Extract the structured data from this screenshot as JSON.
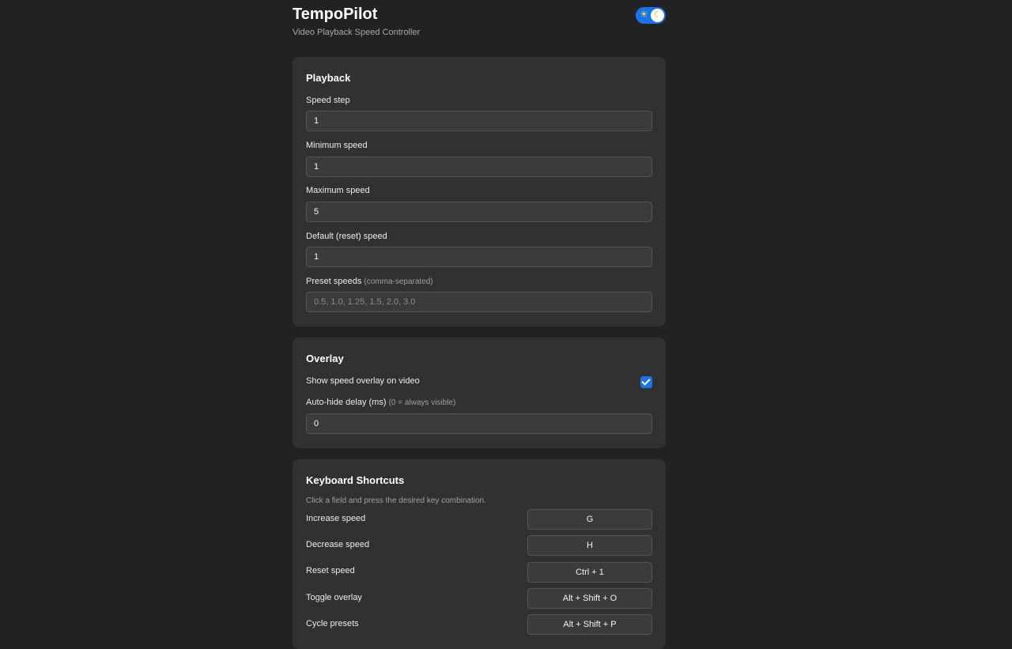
{
  "header": {
    "title": "TempoPilot",
    "subtitle": "Video Playback Speed Controller",
    "theme_toggle": {
      "state": "dark",
      "sun_icon": "sun-icon",
      "moon_icon": "moon-icon",
      "accent": "#1a73e8"
    }
  },
  "playback": {
    "title": "Playback",
    "speed_step": {
      "label": "Speed step",
      "value": "1"
    },
    "min_speed": {
      "label": "Minimum speed",
      "value": "1"
    },
    "max_speed": {
      "label": "Maximum speed",
      "value": "5"
    },
    "default_speed": {
      "label": "Default (reset) speed",
      "value": "1"
    },
    "preset_speeds": {
      "label": "Preset speeds",
      "hint": "(comma-separated)",
      "value": "",
      "placeholder": "0.5, 1.0, 1.25, 1.5, 2.0, 3.0"
    }
  },
  "overlay": {
    "title": "Overlay",
    "show_overlay": {
      "label": "Show speed overlay on video",
      "checked": true
    },
    "auto_hide": {
      "label": "Auto-hide delay (ms)",
      "hint": "(0 = always visible)",
      "value": "0"
    }
  },
  "shortcuts": {
    "title": "Keyboard Shortcuts",
    "note": "Click a field and press the desired key combination.",
    "items": [
      {
        "label": "Increase speed",
        "key": "G"
      },
      {
        "label": "Decrease speed",
        "key": "H"
      },
      {
        "label": "Reset speed",
        "key": "Ctrl + 1"
      },
      {
        "label": "Toggle overlay",
        "key": "Alt + Shift + O"
      },
      {
        "label": "Cycle presets",
        "key": "Alt + Shift + P"
      }
    ]
  }
}
